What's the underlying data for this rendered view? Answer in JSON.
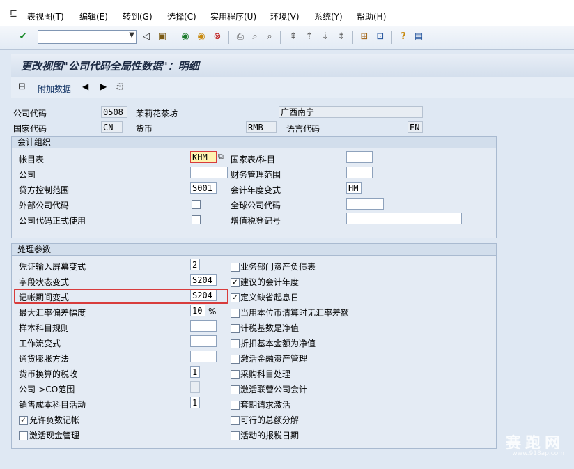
{
  "menu": {
    "items": [
      "表视图(T)",
      "编辑(E)",
      "转到(G)",
      "选择(C)",
      "实用程序(U)",
      "环境(V)",
      "系统(Y)",
      "帮助(H)"
    ]
  },
  "title": "更改视图\"公司代码全局性数据\"：明细",
  "apptoolbar": {
    "extra_label": "附加数据"
  },
  "header": {
    "company_code_label": "公司代码",
    "company_code": "0508",
    "company_name": "茉莉花茶坊",
    "city": "广西南宁",
    "country_label": "国家代码",
    "country": "CN",
    "currency_label": "货币",
    "currency": "RMB",
    "language_label": "语言代码",
    "language": "EN"
  },
  "org": {
    "title": "会计组织",
    "chart_label": "帐目表",
    "chart_value": "KHM",
    "country_chart_label": "国家表/科目",
    "company_label": "公司",
    "fm_area_label": "财务管理范围",
    "credit_area_label": "贷方控制范围",
    "credit_area_value": "S001",
    "fy_variant_label": "会计年度变式",
    "fy_variant_value": "HM",
    "ext_code_label": "外部公司代码",
    "global_code_label": "全球公司代码",
    "productive_label": "公司代码正式使用",
    "vat_label": "增值税登记号"
  },
  "proc": {
    "title": "处理参数",
    "rows_left": [
      {
        "label": "凭证输入屏幕变式",
        "value": "2"
      },
      {
        "label": "字段状态变式",
        "value": "S204"
      },
      {
        "label": "记帐期间变式",
        "value": "S204"
      },
      {
        "label": "最大汇率偏差幅度",
        "value": "10",
        "unit": "%"
      },
      {
        "label": "样本科目规则",
        "value": ""
      },
      {
        "label": "工作流变式",
        "value": ""
      },
      {
        "label": "通货膨胀方法",
        "value": ""
      },
      {
        "label": "货币换算的税收",
        "value": "1"
      },
      {
        "label": "公司->CO范围",
        "value": ""
      },
      {
        "label": "销售成本科目活动",
        "value": "1"
      }
    ],
    "bottom_checks": [
      {
        "label": "允许负数记帐",
        "checked": true
      },
      {
        "label": "激活现金管理",
        "checked": false
      }
    ],
    "checks_right": [
      {
        "label": "业务部门资产负债表",
        "checked": false
      },
      {
        "label": "建议的会计年度",
        "checked": true
      },
      {
        "label": "定义缺省起息日",
        "checked": true
      },
      {
        "label": "当用本位币清算时无汇率差额",
        "checked": false
      },
      {
        "label": "计税基数是净值",
        "checked": false
      },
      {
        "label": "折扣基本金额为净值",
        "checked": false
      },
      {
        "label": "激活金融资产管理",
        "checked": false
      },
      {
        "label": "采购科目处理",
        "checked": false
      },
      {
        "label": "激活联营公司会计",
        "checked": false
      },
      {
        "label": "套期请求激活",
        "checked": false
      },
      {
        "label": "可行的总额分解",
        "checked": false
      },
      {
        "label": "活动的报税日期",
        "checked": false
      }
    ]
  },
  "watermark": "赛跑网",
  "watermark_sub": "www.918ap.com"
}
